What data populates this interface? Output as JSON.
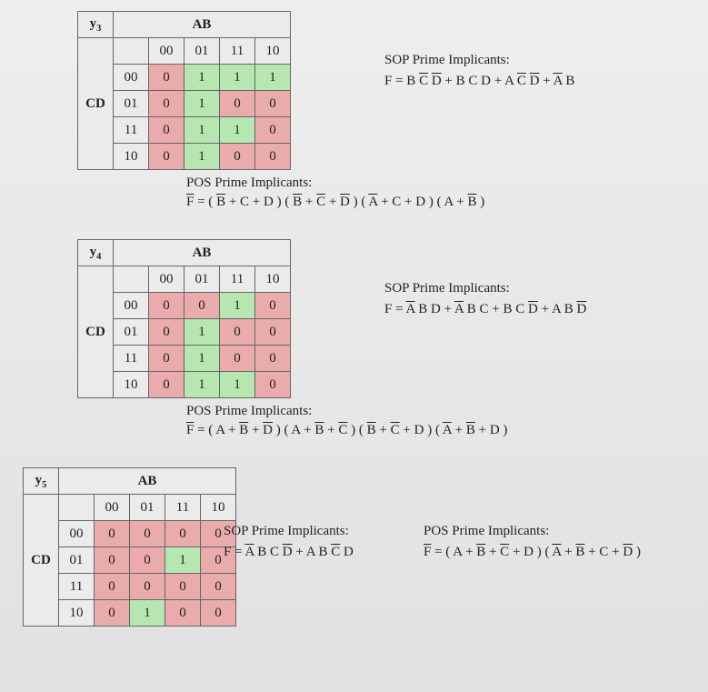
{
  "maps": [
    {
      "y_label_html": "y<sub>3</sub>",
      "col_var": "AB",
      "row_var": "CD",
      "cols": [
        "00",
        "01",
        "11",
        "10"
      ],
      "rows": [
        "00",
        "01",
        "11",
        "10"
      ],
      "cells": [
        [
          "0",
          "1",
          "1",
          "1"
        ],
        [
          "0",
          "1",
          "0",
          "0"
        ],
        [
          "0",
          "1",
          "1",
          "0"
        ],
        [
          "0",
          "1",
          "0",
          "0"
        ]
      ],
      "sop_title": "SOP Prime Implicants:",
      "sop_eq_html": "F = B <span class=\"ov\">C</span> <span class=\"ov\">D</span> + B C D + A <span class=\"ov\">C</span> <span class=\"ov\">D</span> + <span class=\"ov\">A</span> B",
      "pos_title": "POS Prime Implicants:",
      "pos_eq_html": "<span class=\"ov\">F</span> = ( <span class=\"ov\">B</span> + C + D ) ( <span class=\"ov\">B</span> + <span class=\"ov\">C</span> + <span class=\"ov\">D</span> ) ( <span class=\"ov\">A</span> + C + D ) ( A + <span class=\"ov\">B</span> )"
    },
    {
      "y_label_html": "y<sub>4</sub>",
      "col_var": "AB",
      "row_var": "CD",
      "cols": [
        "00",
        "01",
        "11",
        "10"
      ],
      "rows": [
        "00",
        "01",
        "11",
        "10"
      ],
      "cells": [
        [
          "0",
          "0",
          "1",
          "0"
        ],
        [
          "0",
          "1",
          "0",
          "0"
        ],
        [
          "0",
          "1",
          "0",
          "0"
        ],
        [
          "0",
          "1",
          "1",
          "0"
        ]
      ],
      "sop_title": "SOP Prime Implicants:",
      "sop_eq_html": "F = <span class=\"ov\">A</span> B D + <span class=\"ov\">A</span> B C + B C <span class=\"ov\">D</span> + A B <span class=\"ov\">D</span>",
      "pos_title": "POS Prime Implicants:",
      "pos_eq_html": "<span class=\"ov\">F</span> = ( A + <span class=\"ov\">B</span> + <span class=\"ov\">D</span> ) ( A + <span class=\"ov\">B</span> + <span class=\"ov\">C</span> ) ( <span class=\"ov\">B</span> + <span class=\"ov\">C</span> + D ) ( <span class=\"ov\">A</span> + <span class=\"ov\">B</span> + D )"
    },
    {
      "y_label_html": "y<sub>5</sub>",
      "col_var": "AB",
      "row_var": "CD",
      "cols": [
        "00",
        "01",
        "11",
        "10"
      ],
      "rows": [
        "00",
        "01",
        "11",
        "10"
      ],
      "cells": [
        [
          "0",
          "0",
          "0",
          "0"
        ],
        [
          "0",
          "0",
          "1",
          "0"
        ],
        [
          "0",
          "0",
          "0",
          "0"
        ],
        [
          "0",
          "1",
          "0",
          "0"
        ]
      ],
      "sop_title": "SOP Prime Implicants:",
      "sop_eq_html": "F = <span class=\"ov\">A</span> B C <span class=\"ov\">D</span> + A B <span class=\"ov\">C</span> D",
      "pos_title": "POS Prime Implicants:",
      "pos_eq_html": "<span class=\"ov\">F</span> = ( A + <span class=\"ov\">B</span> + <span class=\"ov\">C</span> + D ) ( <span class=\"ov\">A</span> + <span class=\"ov\">B</span> + C + <span class=\"ov\">D</span> )"
    }
  ]
}
